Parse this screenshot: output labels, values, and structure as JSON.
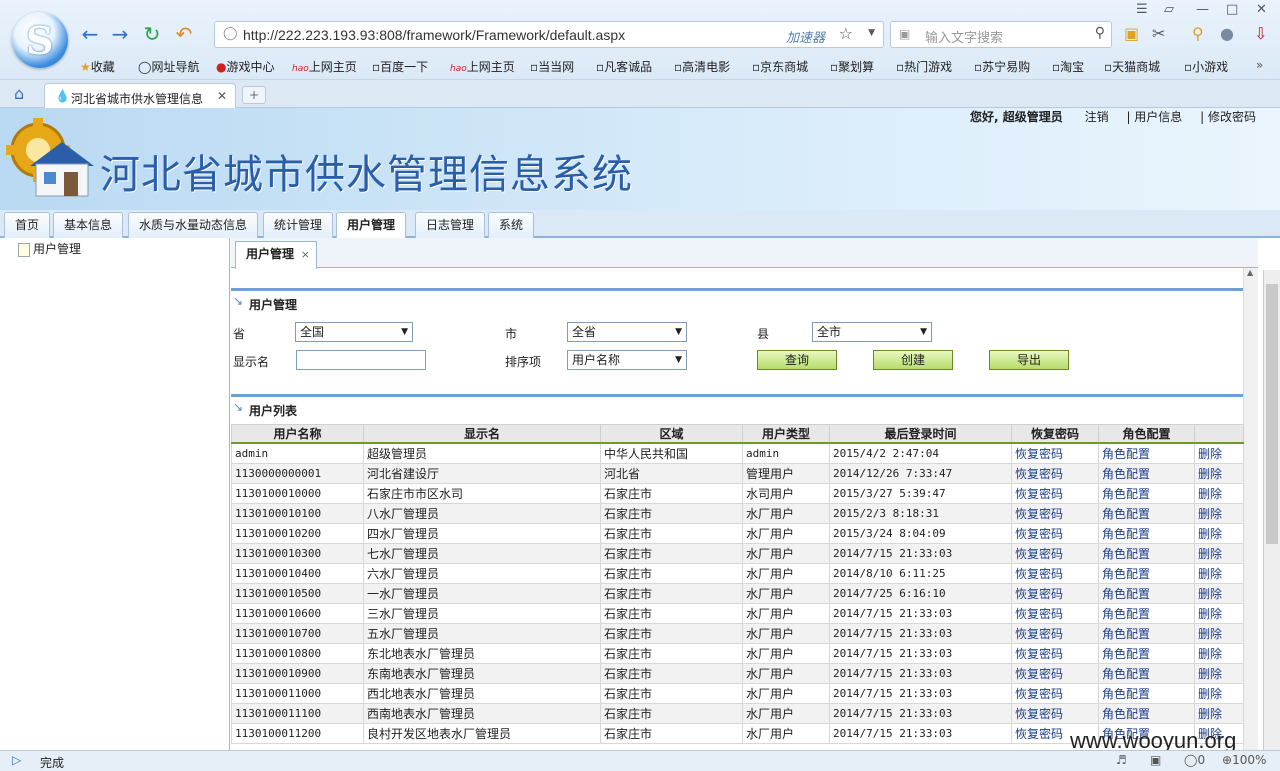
{
  "browser": {
    "url": "http://222.223.193.93:808/framework/Framework/default.aspx",
    "accelerator_label": "加速器",
    "search_placeholder": "输入文字搜索",
    "tab_title": "河北省城市供水管理信息",
    "bookmarks": [
      "收藏",
      "网址导航",
      "游戏中心",
      "上网主页",
      "百度一下",
      "上网主页",
      "当当网",
      "凡客诚品",
      "高清电影",
      "京东商城",
      "聚划算",
      "热门游戏",
      "苏宁易购",
      "淘宝",
      "天猫商城",
      "小游戏"
    ]
  },
  "app": {
    "title": "河北省城市供水管理信息系统",
    "greeting": "您好, 超级管理员",
    "logout": "注销",
    "user_info": "| 用户信息",
    "change_password": "| 修改密码"
  },
  "menu": [
    "首页",
    "基本信息",
    "水质与水量动态信息",
    "统计管理",
    "用户管理",
    "日志管理",
    "系统"
  ],
  "sidebar": {
    "item": "用户管理"
  },
  "inner_tab": "用户管理",
  "filter": {
    "section_title": "用户管理",
    "province_label": "省",
    "province_value": "全国",
    "city_label": "市",
    "city_value": "全省",
    "county_label": "县",
    "county_value": "全市",
    "display_name_label": "显示名",
    "sort_label": "排序项",
    "sort_value": "用户名称",
    "query_btn": "查询",
    "create_btn": "创建",
    "export_btn": "导出"
  },
  "list": {
    "section_title": "用户列表",
    "columns": [
      "用户名称",
      "显示名",
      "区域",
      "用户类型",
      "最后登录时间",
      "恢复密码",
      "角色配置",
      ""
    ],
    "rows": [
      [
        "admin",
        "超级管理员",
        "中华人民共和国",
        "admin",
        "2015/4/2 2:47:04",
        "恢复密码",
        "角色配置",
        "删除"
      ],
      [
        "1130000000001",
        "河北省建设厅",
        "河北省",
        "管理用户",
        "2014/12/26 7:33:47",
        "恢复密码",
        "角色配置",
        "删除"
      ],
      [
        "1130100010000",
        "石家庄市市区水司",
        "石家庄市",
        "水司用户",
        "2015/3/27 5:39:47",
        "恢复密码",
        "角色配置",
        "删除"
      ],
      [
        "1130100010100",
        "八水厂管理员",
        "石家庄市",
        "水厂用户",
        "2015/2/3 8:18:31",
        "恢复密码",
        "角色配置",
        "删除"
      ],
      [
        "1130100010200",
        "四水厂管理员",
        "石家庄市",
        "水厂用户",
        "2015/3/24 8:04:09",
        "恢复密码",
        "角色配置",
        "删除"
      ],
      [
        "1130100010300",
        "七水厂管理员",
        "石家庄市",
        "水厂用户",
        "2014/7/15 21:33:03",
        "恢复密码",
        "角色配置",
        "删除"
      ],
      [
        "1130100010400",
        "六水厂管理员",
        "石家庄市",
        "水厂用户",
        "2014/8/10 6:11:25",
        "恢复密码",
        "角色配置",
        "删除"
      ],
      [
        "1130100010500",
        "一水厂管理员",
        "石家庄市",
        "水厂用户",
        "2014/7/25 6:16:10",
        "恢复密码",
        "角色配置",
        "删除"
      ],
      [
        "1130100010600",
        "三水厂管理员",
        "石家庄市",
        "水厂用户",
        "2014/7/15 21:33:03",
        "恢复密码",
        "角色配置",
        "删除"
      ],
      [
        "1130100010700",
        "五水厂管理员",
        "石家庄市",
        "水厂用户",
        "2014/7/15 21:33:03",
        "恢复密码",
        "角色配置",
        "删除"
      ],
      [
        "1130100010800",
        "东北地表水厂管理员",
        "石家庄市",
        "水厂用户",
        "2014/7/15 21:33:03",
        "恢复密码",
        "角色配置",
        "删除"
      ],
      [
        "1130100010900",
        "东南地表水厂管理员",
        "石家庄市",
        "水厂用户",
        "2014/7/15 21:33:03",
        "恢复密码",
        "角色配置",
        "删除"
      ],
      [
        "1130100011000",
        "西北地表水厂管理员",
        "石家庄市",
        "水厂用户",
        "2014/7/15 21:33:03",
        "恢复密码",
        "角色配置",
        "删除"
      ],
      [
        "1130100011100",
        "西南地表水厂管理员",
        "石家庄市",
        "水厂用户",
        "2014/7/15 21:33:03",
        "恢复密码",
        "角色配置",
        "删除"
      ],
      [
        "1130100011200",
        "良村开发区地表水厂管理员",
        "石家庄市",
        "水厂用户",
        "2014/7/15 21:33:03",
        "恢复密码",
        "角色配置",
        "删除"
      ]
    ]
  },
  "status": {
    "text": "完成",
    "zoom": "100%",
    "count": "0"
  },
  "watermark": "www.wooyun.org"
}
